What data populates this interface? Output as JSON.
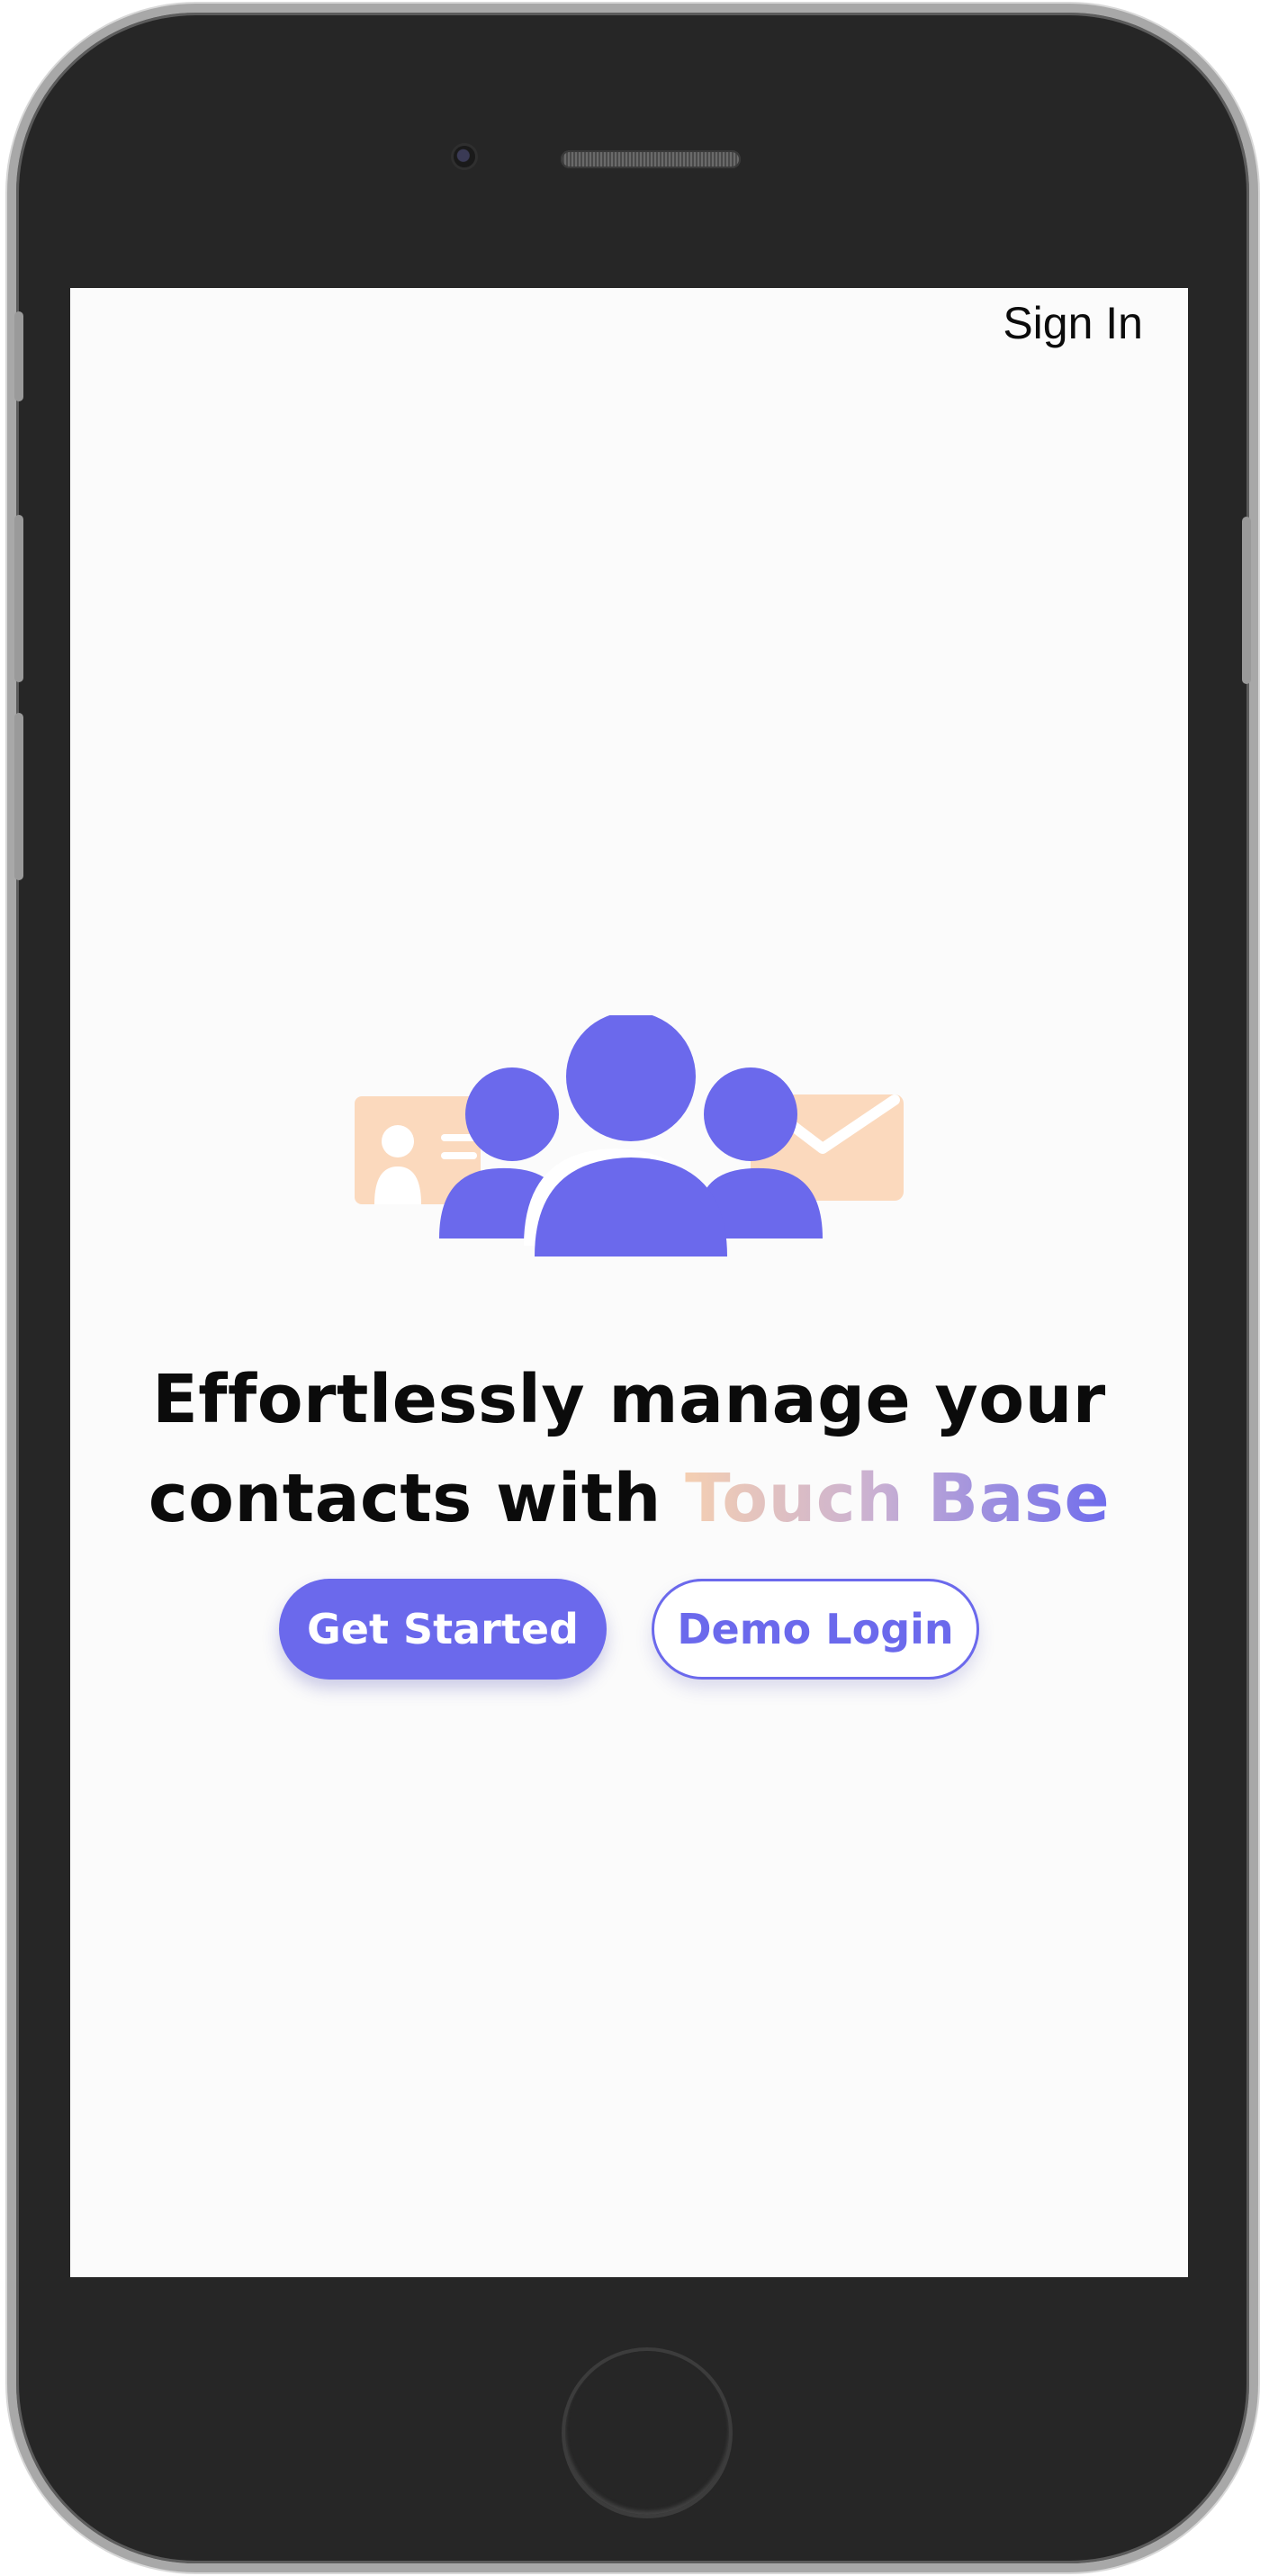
{
  "nav": {
    "sign_in_label": "Sign In"
  },
  "hero": {
    "headline_line1": "Effortlessly manage your",
    "headline_line2_prefix": "contacts with ",
    "brand_name": "Touch Base",
    "illustration_icons": [
      "contact-card-icon",
      "people-group-icon",
      "envelope-icon"
    ]
  },
  "actions": {
    "get_started_label": "Get Started",
    "demo_login_label": "Demo Login"
  },
  "colors": {
    "accent": "#6b69ec",
    "peach": "#fbd9bd",
    "screen_background": "#fbfbfb",
    "text": "#0b0b0b",
    "device_body": "#262626"
  }
}
